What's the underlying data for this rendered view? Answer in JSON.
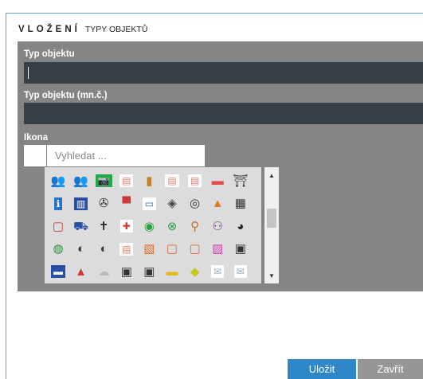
{
  "dialog": {
    "title_main": "VLOŽENÍ",
    "title_sub": "TYPY OBJEKTŮ"
  },
  "form": {
    "type_label": "Typ objektu",
    "type_value": "",
    "type_plural_label": "Typ objektu (mn.č.)",
    "type_plural_value": "",
    "icon_label": "Ikona",
    "search_placeholder": "Vyhledat ..."
  },
  "icons": [
    [
      "people-icon",
      "people-icon",
      "camera-icon",
      "note-icon",
      "chart-icon",
      "note-icon",
      "note-icon",
      "red-flag-icon",
      "gate-icon"
    ],
    [
      "info-icon",
      "building-icon",
      "film-icon",
      "tractor-icon",
      "screen-icon",
      "tray-icon",
      "tires-icon",
      "cone-icon",
      "barcode-icon"
    ],
    [
      "ticket-icon",
      "cart-icon",
      "cross-icon",
      "first-aid-icon",
      "ring-icon",
      "no-entry-icon",
      "pin-icon",
      "family-icon",
      "mask-icon"
    ],
    [
      "pump-icon",
      "roll-icon",
      "roll-icon",
      "note-icon",
      "hatch-icon",
      "frame-icon",
      "frame-icon",
      "stripes-icon",
      "bus-icon"
    ],
    [
      "id-card-icon",
      "rocket-icon",
      "cloud-icon",
      "tag-icon",
      "tag-icon",
      "folder-icon",
      "star-icon",
      "mail-icon",
      "mail-icon"
    ]
  ],
  "buttons": {
    "save": "Uložit",
    "close": "Zavřít"
  }
}
